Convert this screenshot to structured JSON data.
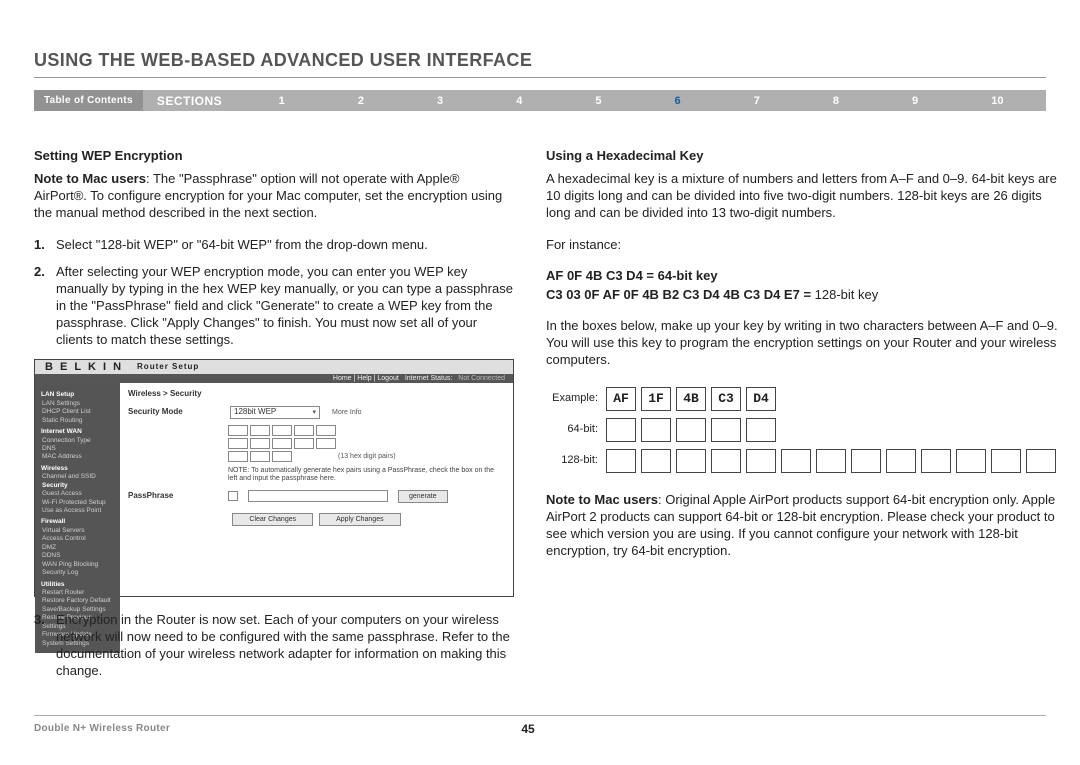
{
  "title": "USING THE WEB-BASED ADVANCED USER INTERFACE",
  "nav": {
    "toc": "Table of Contents",
    "sections_label": "SECTIONS",
    "numbers": [
      "1",
      "2",
      "3",
      "4",
      "5",
      "6",
      "7",
      "8",
      "9",
      "10"
    ],
    "current": "6"
  },
  "left": {
    "heading": "Setting WEP Encryption",
    "note_label": "Note to Mac users",
    "note_text": ": The \"Passphrase\" option will not operate with Apple® AirPort®. To configure encryption for your Mac computer, set the encryption using the manual method described in the next section.",
    "step1": "Select \"128-bit WEP\" or \"64-bit WEP\" from the drop-down menu.",
    "step2": "After selecting your WEP encryption mode, you can enter you WEP key manually by typing in the hex WEP key manually, or you can type a passphrase in the \"PassPhrase\" field and click \"Generate\" to create a WEP key from the passphrase. Click \"Apply Changes\" to finish. You must now set all of your clients to match these settings.",
    "step3": "Encryption in the Router is now set. Each of your computers on your wireless network will now need to be configured with the same passphrase. Refer to the documentation of your wireless network adapter for information on making this change.",
    "step_nums": {
      "n1": "1.",
      "n2": "2.",
      "n3": "3."
    }
  },
  "router": {
    "brand": "B E L K I N",
    "setup": "Router Setup",
    "meta_links": "Home | Help | Logout",
    "meta_status_label": "Internet Status:",
    "meta_status_value": "Not Connected",
    "crumb": "Wireless > Security",
    "security_mode_label": "Security Mode",
    "security_mode_value": "128bit WEP",
    "more_info": "More Info",
    "hex_hint": "(13 hex digit pairs)",
    "note_label": "NOTE:",
    "note_text": "To automatically generate hex pairs using a PassPhrase, check the box on the left and input the passphrase here.",
    "passphrase_label": "PassPhrase",
    "generate": "generate",
    "clear": "Clear Changes",
    "apply": "Apply Changes",
    "side": {
      "groups": [
        {
          "header": "LAN Setup",
          "items": [
            "LAN Settings",
            "DHCP Client List",
            "Static Routing"
          ]
        },
        {
          "header": "Internet WAN",
          "items": [
            "Connection Type",
            "DNS",
            "MAC Address"
          ]
        },
        {
          "header": "Wireless",
          "items": [
            "Channel and SSID",
            "Security",
            "Guest Access",
            "Wi-Fi Protected Setup",
            "Use as Access Point"
          ]
        },
        {
          "header": "Firewall",
          "items": [
            "Virtual Servers",
            "Access Control",
            "DMZ",
            "DDNS",
            "WAN Ping Blocking",
            "Security Log"
          ]
        },
        {
          "header": "Utilities",
          "items": [
            "Restart Router",
            "Restore Factory Default",
            "Save/Backup Settings",
            "Restore Previous Settings",
            "Firmware Update",
            "System Settings"
          ]
        }
      ]
    }
  },
  "right": {
    "heading": "Using a Hexadecimal Key",
    "p1": "A hexadecimal key is a mixture of numbers and letters from A–F and 0–9. 64-bit keys are 10 digits long and can be divided into five two-digit numbers. 128-bit keys are 26 digits long and can be divided into 13 two-digit numbers.",
    "for_instance": "For instance:",
    "ex64_bold": "AF 0F 4B C3 D4 = 64-bit key",
    "ex128_bold": "C3 03 0F AF 0F 4B B2 C3 D4 4B C3 D4 E7 =",
    "ex128_tail": " 128-bit key",
    "p2": "In the boxes below, make up your key by writing in two characters between A–F and 0–9. You will use this key to program the encryption settings on your Router and your wireless computers.",
    "labels": {
      "example": "Example:",
      "b64": "64-bit:",
      "b128": "128-bit:"
    },
    "example_vals": [
      "AF",
      "1F",
      "4B",
      "C3",
      "D4"
    ],
    "final_note_label": "Note to Mac users",
    "final_note": ": Original Apple AirPort products support 64-bit encryption only. Apple AirPort 2 products can support 64-bit or 128-bit encryption. Please check your product to see which version you are using. If you cannot configure your network with 128-bit encryption, try 64-bit encryption."
  },
  "footer": {
    "product": "Double N+ Wireless Router",
    "page": "45"
  }
}
